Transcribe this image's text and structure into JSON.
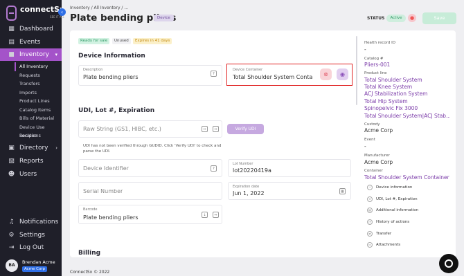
{
  "app": {
    "brand": "connectSx",
    "brand_sub": "SEE IT ALL"
  },
  "sidebar": {
    "collapse_icon": "chevron-left-icon",
    "items": [
      {
        "label": "Dashboard",
        "icon": "dashboard-icon"
      },
      {
        "label": "Events",
        "icon": "calendar-icon"
      },
      {
        "label": "Inventory",
        "icon": "box-icon",
        "active": true
      },
      {
        "label": "Directory",
        "icon": "directory-icon"
      },
      {
        "label": "Reports",
        "icon": "reports-icon"
      },
      {
        "label": "Users",
        "icon": "users-icon"
      },
      {
        "label": "Notifications",
        "icon": "bell-icon"
      },
      {
        "label": "Settings",
        "icon": "gear-icon"
      },
      {
        "label": "Log Out",
        "icon": "logout-icon"
      }
    ],
    "inventory_sub": [
      "All Inventory",
      "Requests",
      "Transfers",
      "Imports",
      "Product Lines",
      "Catalog Items",
      "Bills of Material",
      "Device Use Recipes",
      "Locations"
    ],
    "user": {
      "initials": "BA",
      "name": "Brendan Acme",
      "org": "Acme Corp"
    }
  },
  "header": {
    "breadcrumb": "Inventory / All Inventory / ...",
    "title": "Plate bending pliers",
    "type_badge": "Device",
    "status_label": "STATUS",
    "status_value": "Active",
    "save_label": "Save"
  },
  "tags": [
    "Ready for sale",
    "Unused",
    "Expires in 41 days"
  ],
  "colors": {
    "accent": "#a453c9",
    "sidebar_bg": "#1f1f29",
    "highlight": "#e02020"
  },
  "device_info": {
    "heading": "Device Information",
    "description_label": "Description",
    "description_value": "Plate bending pliers",
    "container_label": "Device Container",
    "container_value": "Total Shoulder System Container"
  },
  "udi": {
    "heading": "UDI, Lot #, Expiration",
    "raw_placeholder": "Raw String (GS1, HIBC, etc.)",
    "verify_label": "Verify UDI",
    "note": "UDI has not been verified through GUDID. Click 'Verify UDI' to check and parse the UDI.",
    "device_identifier_placeholder": "Device Identifier",
    "lot_label": "Lot Number",
    "lot_value": "lot20220419a",
    "serial_placeholder": "Serial Number",
    "expiration_label": "Expiration date",
    "expiration_value": "Jun 1, 2022",
    "barcode_label": "Barcode",
    "barcode_value": "Plate bending pliers"
  },
  "partial_heading": "Billing",
  "right_panel": {
    "health_label": "Health record ID",
    "health_value": "-",
    "catalog_label": "Catalog #",
    "catalog_value": "Pliers-001",
    "product_line_label": "Product line",
    "product_lines": [
      "Total Shoulder System",
      "Total Knee System",
      "ACJ Stabilization System",
      "Total Hip System",
      "Spinopelvic Fix 3000",
      "Total Shoulder System|ACJ Stab..."
    ],
    "custody_label": "Custody",
    "custody_value": "Acme Corp",
    "event_label": "Event",
    "event_value": "-",
    "manufacturer_label": "Manufacturer",
    "manufacturer_value": "Acme Corp",
    "container_label": "Container",
    "container_value": "Total Shoulder System Container",
    "toc": [
      "Device information",
      "UDI, Lot #, Expiration",
      "Additional information",
      "History of actions",
      "Transfer",
      "Attachments"
    ]
  },
  "footer": "ConnectSx © 2022"
}
